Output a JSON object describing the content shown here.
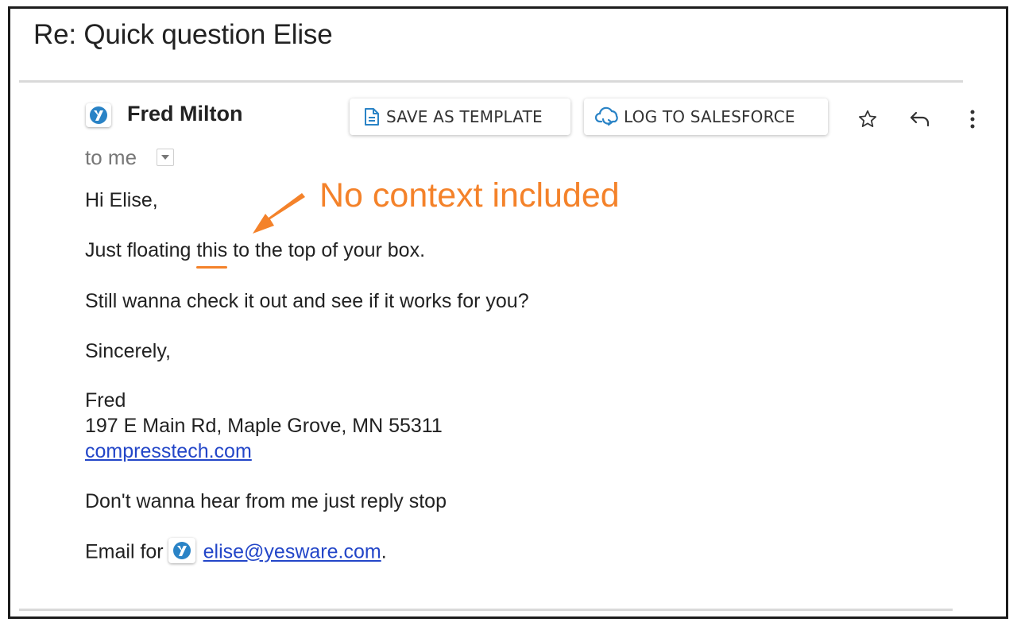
{
  "email": {
    "subject": "Re: Quick question Elise",
    "sender_name": "Fred Milton",
    "recipient_label": "to me",
    "toolbar": {
      "save_template_label": "SAVE AS TEMPLATE",
      "log_salesforce_label": "LOG TO SALESFORCE"
    },
    "body": {
      "greeting": "Hi Elise,",
      "line1_before": "Just floating ",
      "line1_highlight": "this",
      "line1_after": " to the top of your box.",
      "line2": "Still wanna check it out and see if it works for you?",
      "closing": "Sincerely,",
      "signature_name": "Fred",
      "signature_address": "197 E Main Rd, Maple Grove, MN 55311",
      "signature_link": "compresstech.com",
      "unsubscribe_text": "Don't wanna hear from me just reply stop",
      "email_for_label": "Email for",
      "email_for_address": "elise@yesware.com",
      "email_for_suffix": "."
    }
  },
  "annotation": {
    "text": "No context included",
    "color": "#f4822a"
  },
  "colors": {
    "brand_blue": "#2a83c6",
    "link_blue": "#2346c8",
    "accent_orange": "#f4822a"
  }
}
